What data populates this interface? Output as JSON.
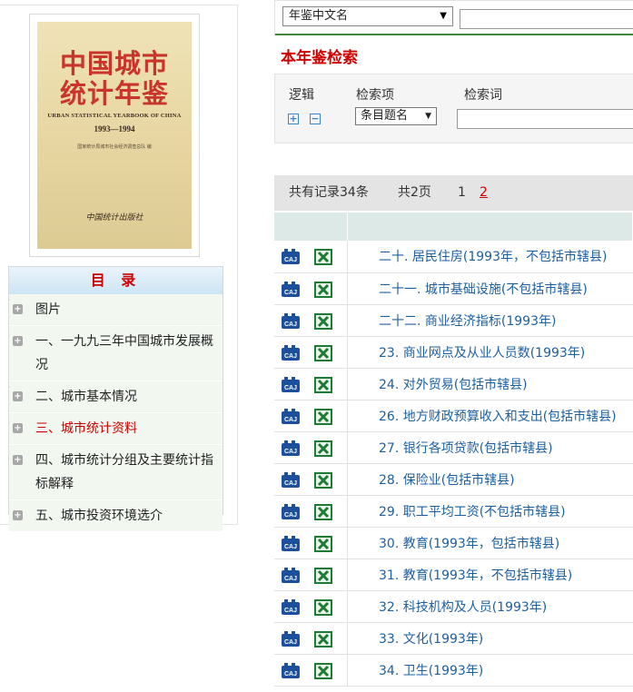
{
  "cover": {
    "title_line1": "中国城市",
    "title_line2": "统计年鉴",
    "english": "URBAN STATISTICAL YEARBOOK OF CHINA",
    "years": "1993—1994",
    "editor": "国家统计局城市社会经济调查总队 编",
    "publisher": "中国统计出版社"
  },
  "toc": {
    "header": "目 录",
    "items": [
      {
        "label": "图片",
        "active": false
      },
      {
        "label": "一、一九九三年中国城市发展概况",
        "active": false
      },
      {
        "label": "二、城市基本情况",
        "active": false
      },
      {
        "label": "三、城市统计资料",
        "active": true
      },
      {
        "label": "四、城市统计分组及主要统计指标解释",
        "active": false
      },
      {
        "label": "五、城市投资环境选介",
        "active": false
      }
    ]
  },
  "search": {
    "select_value": "年鉴中文名",
    "input_value": ""
  },
  "filter": {
    "section_title": "本年鉴检索",
    "logic_label": "逻辑",
    "field_label": "检索项",
    "term_label": "检索词",
    "add_symbol": "+",
    "remove_symbol": "−",
    "field_value": "条目题名",
    "term_value": ""
  },
  "records": {
    "total": "共有记录34条",
    "pages": "共2页",
    "page1": "1",
    "page2": "2"
  },
  "results": [
    "二十. 居民住房(1993年，不包括市辖县)",
    "二十一. 城市基础设施(不包括市辖县)",
    "二十二. 商业经济指标(1993年)",
    "23. 商业网点及从业人员数(1993年)",
    "24. 对外贸易(包括市辖县)",
    "26. 地方财政预算收入和支出(包括市辖县)",
    "27. 银行各项贷款(包括市辖县)",
    "28. 保险业(包括市辖县)",
    "29. 职工平均工资(不包括市辖县)",
    "30. 教育(1993年，包括市辖县)",
    "31. 教育(1993年，不包括市辖县)",
    "32. 科技机构及人员(1993年)",
    "33. 文化(1993年)",
    "34. 卫生(1993年)"
  ],
  "colors": {
    "accent_red": "#cc0000",
    "link_blue": "#1e5fa0",
    "caj_blue": "#1c4f9c",
    "excel_green": "#1e7b34"
  }
}
